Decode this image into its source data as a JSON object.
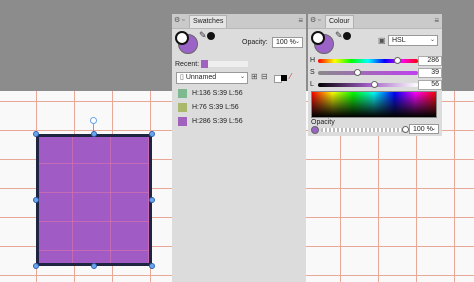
{
  "swatches_panel": {
    "tab_label": "Swatches",
    "opacity_label": "Opacity:",
    "opacity_value": "100 %",
    "recent_label": "Recent:",
    "palette_name": "Unnamed",
    "swatch_items": [
      {
        "label": "H:136 S:39 L:56",
        "color": "#7fb98f"
      },
      {
        "label": "H:76 S:39 L:56",
        "color": "#a9b86a"
      },
      {
        "label": "H:286 S:39 L:56",
        "color": "#a062bd"
      }
    ]
  },
  "colour_panel": {
    "tab_label": "Colour",
    "mode": "HSL",
    "sliders": [
      {
        "label": "H",
        "value": "286",
        "fraction": 0.79
      },
      {
        "label": "S",
        "value": "39",
        "fraction": 0.39
      },
      {
        "label": "L",
        "value": "56",
        "fraction": 0.56
      }
    ],
    "opacity_label": "Opacity",
    "opacity_value": "100 %",
    "opacity_fraction": 1.0
  },
  "colors": {
    "fill": "#a05cc4",
    "accent": "#6aa6e8"
  }
}
